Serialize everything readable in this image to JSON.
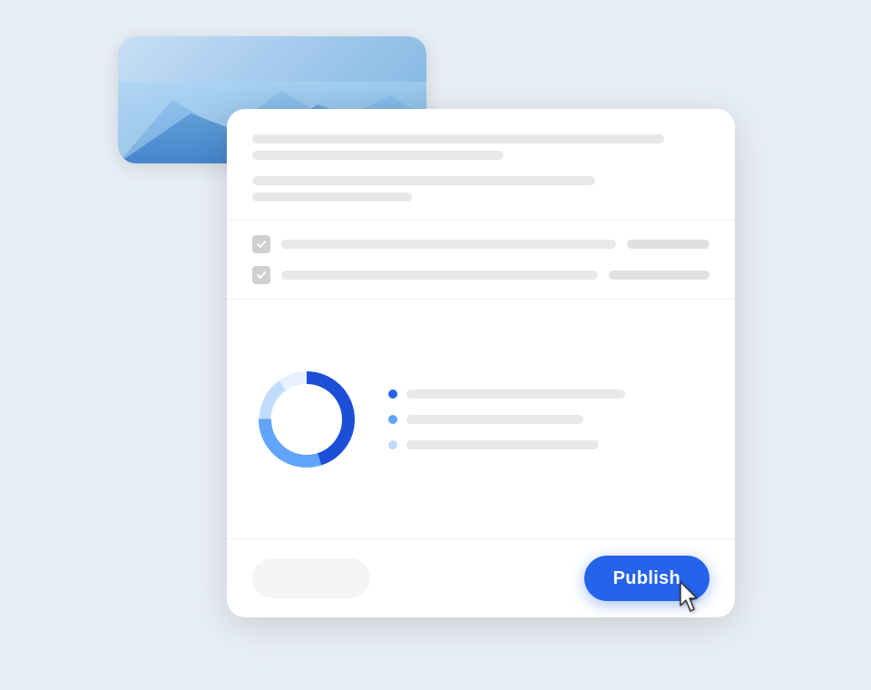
{
  "scene": {
    "background_color": "#e8eef5"
  },
  "image_card": {
    "alt": "Mountain landscape chart"
  },
  "main_panel": {
    "top_lines": [
      {
        "width": "88%"
      },
      {
        "width": "55%"
      },
      {
        "width": "72%"
      },
      {
        "width": "40%"
      }
    ],
    "checkbox_rows": [
      {
        "checked": true,
        "line_width": "78%",
        "tag_width": "18%"
      },
      {
        "checked": true,
        "line_width": "65%",
        "tag_width": "22%"
      }
    ],
    "chart": {
      "donut": {
        "segments": [
          {
            "color": "#1d4ed8",
            "value": 45,
            "offset": 0
          },
          {
            "color": "#60a5fa",
            "value": 30,
            "offset": 45
          },
          {
            "color": "#bfdbfe",
            "value": 15,
            "offset": 75
          }
        ],
        "track_color": "#e8f0fe"
      },
      "legend_items": [
        {
          "dot_color": "blue-dark",
          "line_width": "68%"
        },
        {
          "dot_color": "blue-mid",
          "line_width": "55%"
        },
        {
          "dot_color": "blue-light",
          "line_width": "60%"
        }
      ]
    },
    "footer": {
      "secondary_button_label": "",
      "publish_button_label": "Publish"
    }
  },
  "cursor": {
    "symbol": "☞"
  }
}
